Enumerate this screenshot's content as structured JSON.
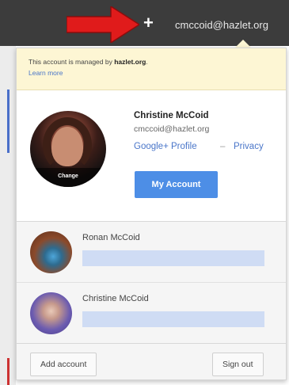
{
  "topbar": {
    "plus_symbol": "+",
    "account_email": "cmccoid@hazlet.org"
  },
  "managed_notice": {
    "text_prefix": "This account is managed by ",
    "domain": "hazlet.org",
    "text_suffix": ".",
    "learn_more": "Learn more"
  },
  "current_user": {
    "name": "Christine McCoid",
    "email": "cmccoid@hazlet.org",
    "profile_link": "Google+ Profile",
    "separator": "–",
    "privacy_link": "Privacy",
    "change_photo": "Change",
    "my_account_button": "My Account"
  },
  "other_accounts": [
    {
      "name": "Ronan McCoid"
    },
    {
      "name": "Christine McCoid"
    }
  ],
  "footer": {
    "add_account": "Add account",
    "sign_out": "Sign out"
  },
  "colors": {
    "topbar": "#3c3c3c",
    "notice_bg": "#fdf6d4",
    "link": "#4a76c9",
    "primary_button": "#4d8ee6",
    "arrow": "#e01b1b"
  }
}
